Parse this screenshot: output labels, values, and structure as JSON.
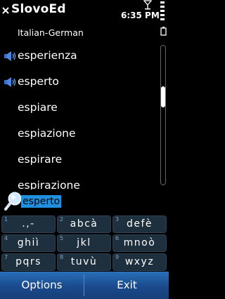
{
  "app": {
    "title": "SlovoEd",
    "dictionary": "Italian-German"
  },
  "status": {
    "time": "6:35 PM"
  },
  "words": [
    {
      "text": "esperienza",
      "has_audio": true
    },
    {
      "text": "esperto",
      "has_audio": true
    },
    {
      "text": "espiare",
      "has_audio": false
    },
    {
      "text": "espiazione",
      "has_audio": false
    },
    {
      "text": "espirare",
      "has_audio": false
    },
    {
      "text": "espirazione",
      "has_audio": false
    }
  ],
  "search": {
    "value": "esperto"
  },
  "keypad": [
    {
      "num": "1",
      "letters": ".,-"
    },
    {
      "num": "2",
      "letters": "abcà"
    },
    {
      "num": "3",
      "letters": "defè"
    },
    {
      "num": "4",
      "letters": "ghiì"
    },
    {
      "num": "5",
      "letters": "jkl"
    },
    {
      "num": "6",
      "letters": "mnoò"
    },
    {
      "num": "7",
      "letters": "pqrs"
    },
    {
      "num": "8",
      "letters": "tuvù"
    },
    {
      "num": "9",
      "letters": "wxyz"
    }
  ],
  "softkeys": {
    "left": "Options",
    "right": "Exit"
  },
  "colors": {
    "highlight": "#1f8fde",
    "softkey_bar": "#1a4a8c",
    "key_bg": "#1e2f3e"
  },
  "icons": [
    "close-icon",
    "signal-icon",
    "signal-strength-icon",
    "battery-icon",
    "speaker-icon",
    "search-icon"
  ]
}
